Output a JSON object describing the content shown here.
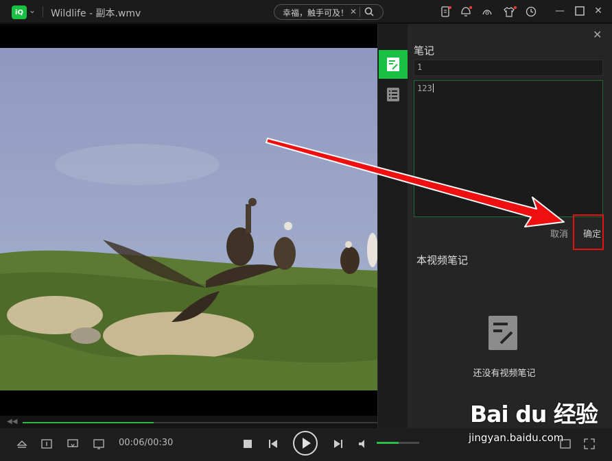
{
  "titlebar": {
    "title": "Wildlife - 副本.wmv",
    "logo_text": "iQ",
    "search_text": "幸福，触手可及！",
    "icons": [
      "phone-icon",
      "notification-icon",
      "skin-icon",
      "shirt-icon",
      "history-icon"
    ],
    "window_controls": [
      "minimize-icon",
      "maximize-icon",
      "close-icon"
    ]
  },
  "player": {
    "progress_fraction": 0.37,
    "time": "00:06/00:30",
    "volume_fraction": 0.52
  },
  "notes_panel": {
    "heading": "笔记",
    "title_value": "1",
    "body_value": "123",
    "cancel_label": "取消",
    "confirm_label": "确定",
    "section_title": "本视频笔记",
    "empty_text": "还没有视频笔记"
  },
  "side_tabs": [
    "note-tab",
    "list-tab"
  ],
  "watermark": {
    "brand": "Bai du 经验",
    "sub": "jingyan.baidu.com"
  },
  "colors": {
    "accent": "#19c043",
    "annotation_red": "#e81010",
    "panel_bg": "#252525"
  }
}
